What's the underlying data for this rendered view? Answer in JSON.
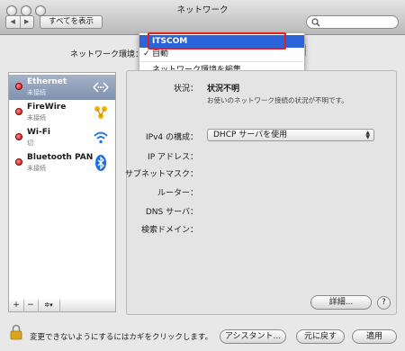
{
  "window": {
    "title": "ネットワーク"
  },
  "toolbar": {
    "back": "◀",
    "forward": "▶",
    "show_all": "すべてを表示"
  },
  "location": {
    "label": "ネットワーク環境：",
    "menu": {
      "items": [
        {
          "label": "ITSCOM",
          "selected": true
        },
        {
          "label": "自動",
          "checked": true
        },
        {
          "label": "ネットワーク環境を編集..."
        }
      ]
    }
  },
  "sidebar": {
    "services": [
      {
        "name": "Ethernet",
        "status": "未接続",
        "icon": "ethernet-icon"
      },
      {
        "name": "FireWire",
        "status": "未接続",
        "icon": "firewire-icon"
      },
      {
        "name": "Wi-Fi",
        "status": "切",
        "icon": "wifi-icon"
      },
      {
        "name": "Bluetooth PAN",
        "status": "未接続",
        "icon": "bluetooth-icon"
      }
    ],
    "tools": {
      "add": "+",
      "remove": "−",
      "action": "✲▾"
    }
  },
  "detail": {
    "status_label": "状況：",
    "status_value": "状況不明",
    "status_desc": "お使いのネットワーク接続の状況が不明です。",
    "ipv4_label": "IPv4 の構成：",
    "ipv4_value": "DHCP サーバを使用",
    "fields": [
      "IP アドレス：",
      "サブネットマスク：",
      "ルーター：",
      "DNS サーバ：",
      "検索ドメイン："
    ],
    "advanced": "詳細...",
    "help": "?"
  },
  "footer": {
    "lock_text": "変更できないようにするにはカギをクリックします。",
    "assistant": "アシスタント...",
    "revert": "元に戻す",
    "apply": "適用"
  },
  "colors": {
    "selection": "#2b64d8",
    "highlight": "#e02020",
    "status_dot": "#c01010"
  }
}
